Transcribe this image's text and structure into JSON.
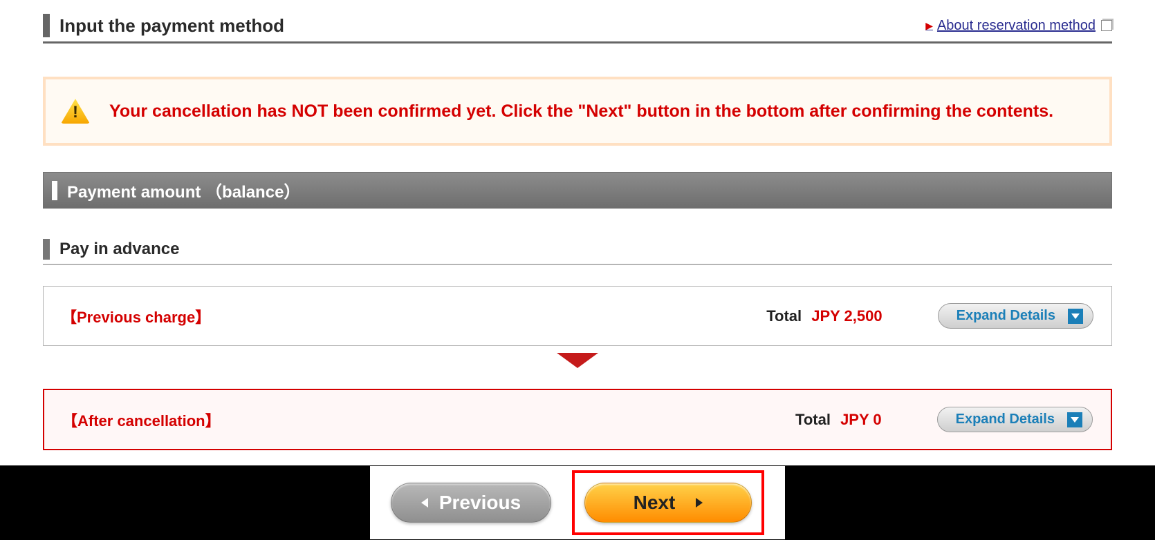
{
  "header": {
    "title": "Input the payment method",
    "about_link": "About reservation method"
  },
  "warning": {
    "message": "Your cancellation has NOT been confirmed yet. Click the \"Next\" button in the bottom after confirming the contents."
  },
  "payment_section": {
    "title": "Payment amount （balance）",
    "pay_in_advance": "Pay in advance"
  },
  "previous_charge": {
    "label": "【Previous charge】",
    "total_label": "Total",
    "amount": "JPY 2,500",
    "expand": "Expand Details"
  },
  "after_cancellation": {
    "label": "【After cancellation】",
    "total_label": "Total",
    "amount": "JPY 0",
    "expand": "Expand Details"
  },
  "nav": {
    "previous": "Previous",
    "next": "Next"
  }
}
